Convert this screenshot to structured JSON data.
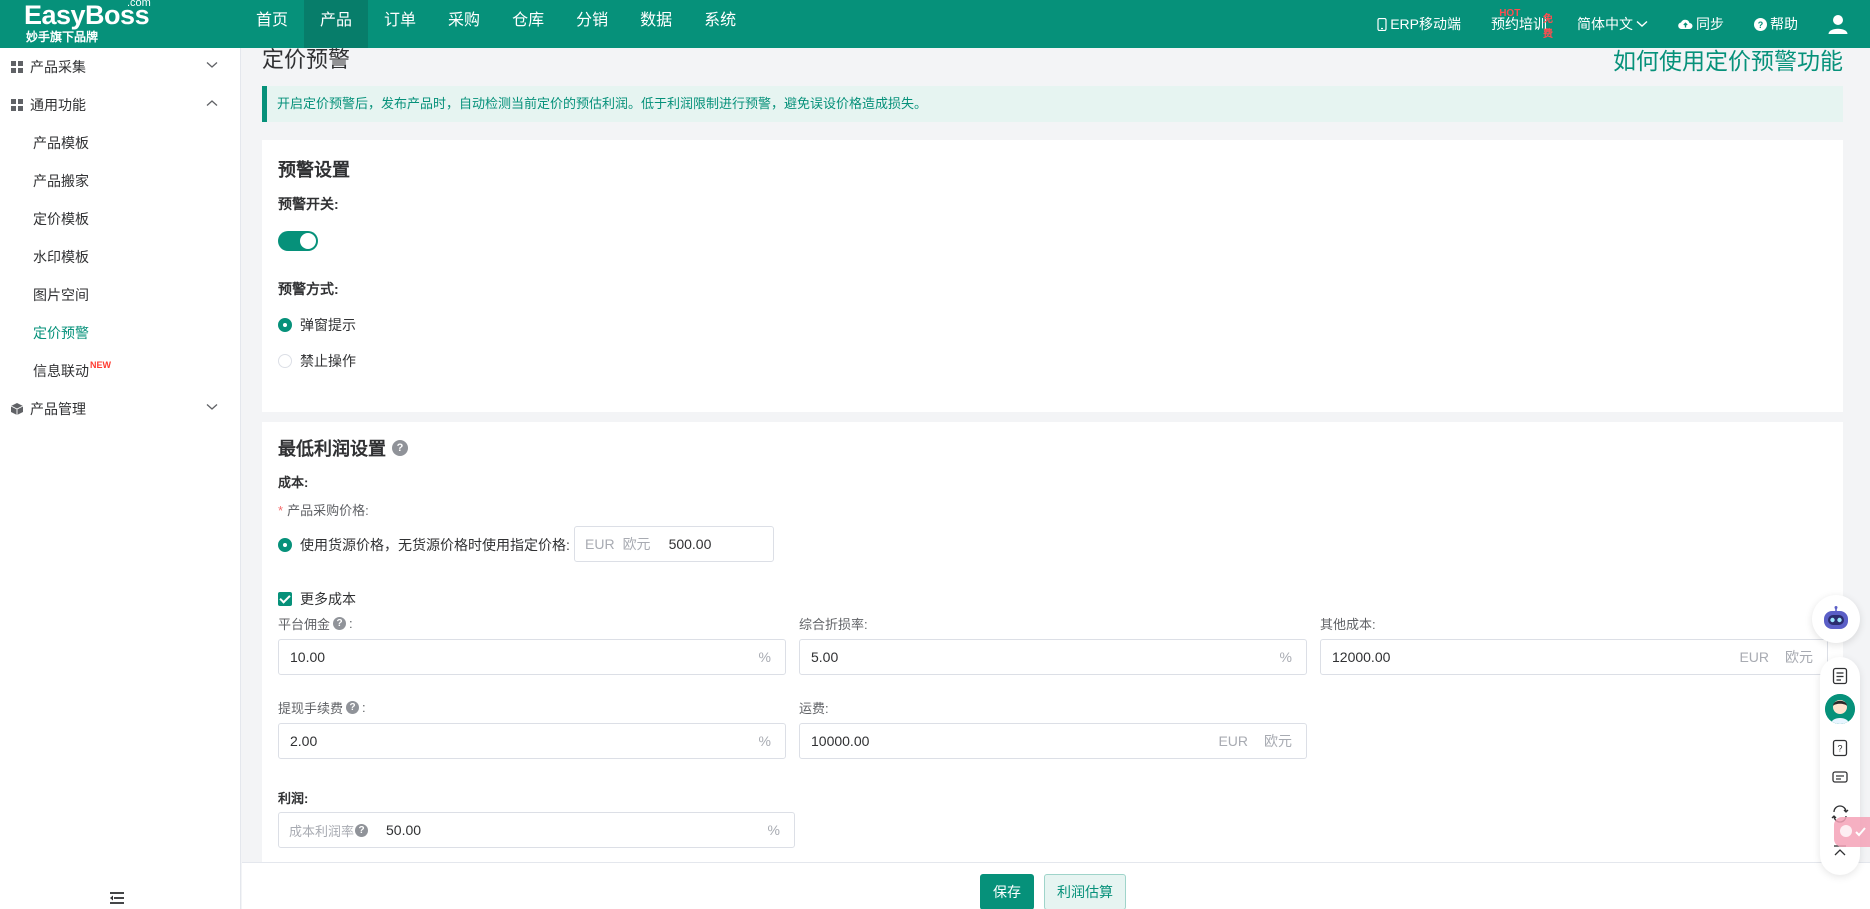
{
  "brand": {
    "name": "EasyBoss",
    "com": ".com",
    "slogan": "妙手旗下品牌"
  },
  "nav": {
    "items": [
      "首页",
      "产品",
      "订单",
      "采购",
      "仓库",
      "分销",
      "数据",
      "系统"
    ],
    "active": "产品"
  },
  "topright": {
    "erp": "ERP移动端",
    "erp_badge": "HOT",
    "training": "预约培训",
    "training_badge": "免费",
    "language": "简体中文",
    "sync": "同步",
    "help": "帮助"
  },
  "sidebar": {
    "group1": "产品采集",
    "group2": "通用功能",
    "items": [
      "产品模板",
      "产品搬家",
      "定价模板",
      "水印模板",
      "图片空间",
      "定价预警",
      "信息联动"
    ],
    "active": "定价预警",
    "new_badge": "NEW",
    "group3": "产品管理"
  },
  "page": {
    "title": "定价预警",
    "help_link": "如何使用定价预警功能",
    "notice": "开启定价预警后，发布产品时，自动检测当前定价的预估利润。低于利润限制进行预警，避免误设价格造成损失。"
  },
  "warning": {
    "title": "预警设置",
    "switch_label": "预警开关:",
    "switch_on": true,
    "mode_label": "预警方式:",
    "mode_options": [
      "弹窗提示",
      "禁止操作"
    ],
    "mode_selected": "弹窗提示"
  },
  "profit": {
    "title": "最低利润设置",
    "cost_label": "成本:",
    "purchase_label": "产品采购价格:",
    "purchase_option": "使用货源价格，无货源价格时使用指定价格:",
    "purchase_currency": "EUR",
    "purchase_currency_cn": "欧元",
    "purchase_value": "500.00",
    "more_cost": "更多成本",
    "commission_label": "平台佣金",
    "commission_value": "10.00",
    "discount_label": "综合折损率:",
    "discount_value": "5.00",
    "other_label": "其他成本:",
    "other_value": "12000.00",
    "withdraw_label": "提现手续费",
    "withdraw_value": "2.00",
    "shipping_label": "运费:",
    "shipping_value": "10000.00",
    "profit_label": "利润:",
    "margin_prefix": "成本利润率",
    "margin_value": "50.00",
    "percent": "%",
    "colon": ":",
    "currency": "EUR",
    "currency_cn": "欧元"
  },
  "actions": {
    "save": "保存",
    "estimate": "利润估算"
  },
  "colors": {
    "primary": "#06917a",
    "danger": "#ff4d4f"
  }
}
